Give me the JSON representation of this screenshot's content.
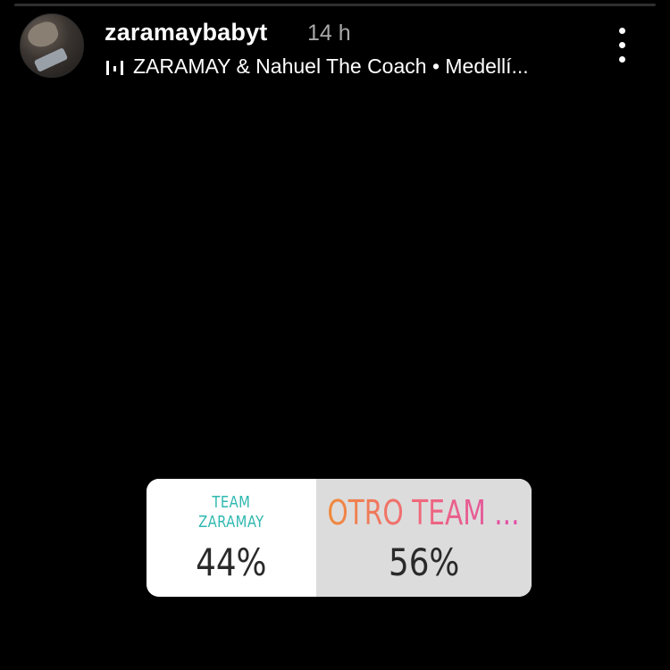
{
  "header": {
    "username": "zaramaybabyt",
    "time_ago": "14 h",
    "music": {
      "icon": "music-bars-icon",
      "text": "ZARAMAY & Nahuel The Coach • Medellí..."
    },
    "more_icon": "more-vertical-icon"
  },
  "poll": {
    "options": [
      {
        "label": "TEAM\nZARAMAY",
        "percent": "44%",
        "color": "#2fb8b0"
      },
      {
        "label": "OTRO TEAM ...",
        "percent": "56%",
        "color": "#e04fa8"
      }
    ],
    "left_fraction": 0.44,
    "right_fraction": 0.56
  }
}
